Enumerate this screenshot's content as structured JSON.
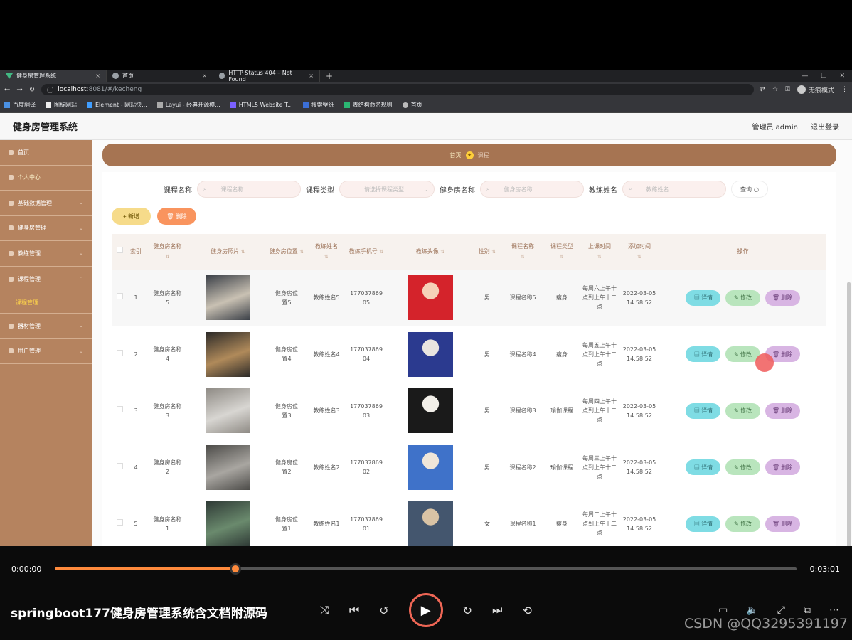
{
  "browser": {
    "tabs": [
      {
        "title": "健身房管理系统",
        "close": "×"
      },
      {
        "title": "首页",
        "close": "×"
      },
      {
        "title": "HTTP Status 404 – Not Found",
        "close": "×"
      }
    ],
    "new_tab": "+",
    "url_host": "localhost",
    "url_path": ":8081/#/kecheng",
    "incognito": "无痕模式",
    "bookmarks": [
      "百度翻译",
      "图标网站",
      "Element - 网站快...",
      "Layui - 经典开源模...",
      "HTML5 Website T...",
      "搜索壁纸",
      "表结构命名规则",
      "首页"
    ]
  },
  "app": {
    "title": "健身房管理系统",
    "user": "管理员 admin",
    "logout": "退出登录"
  },
  "sidebar": {
    "items": [
      {
        "label": "首页"
      },
      {
        "label": "个人中心"
      },
      {
        "label": "基础数据管理"
      },
      {
        "label": "健身房管理"
      },
      {
        "label": "教练管理"
      },
      {
        "label": "课程管理"
      },
      {
        "label": "器材管理"
      },
      {
        "label": "用户管理"
      }
    ],
    "sub_active": "课程管理"
  },
  "breadcrumb": {
    "home": "首页",
    "current": "课程"
  },
  "search": {
    "course_name_label": "课程名称",
    "course_name_placeholder": "课程名称",
    "course_type_label": "课程类型",
    "course_type_placeholder": "请选择课程类型",
    "gym_name_label": "健身房名称",
    "gym_name_placeholder": "健身房名称",
    "coach_name_label": "教练姓名",
    "coach_name_placeholder": "教练姓名",
    "query": "查询"
  },
  "actions": {
    "add": "+ 新增",
    "delete": "删除"
  },
  "table": {
    "headers": [
      "索引",
      "健身房名称",
      "健身房照片",
      "健身房位置",
      "教练姓名",
      "教练手机号",
      "教练头像",
      "性别",
      "课程名称",
      "课程类型",
      "上课时间",
      "添加时间",
      "操作"
    ],
    "rows": [
      {
        "index": "1",
        "gym": "健身房名称5",
        "location": "健身房位置5",
        "coach": "教练姓名5",
        "phone": "17703786905",
        "gender": "男",
        "course": "课程名称5",
        "type": "瘦身",
        "time": "每周六上午十点到上午十二点",
        "added": "2022-03-05 14:58:52"
      },
      {
        "index": "2",
        "gym": "健身房名称4",
        "location": "健身房位置4",
        "coach": "教练姓名4",
        "phone": "17703786904",
        "gender": "男",
        "course": "课程名称4",
        "type": "瘦身",
        "time": "每周五上午十点到上午十二点",
        "added": "2022-03-05 14:58:52"
      },
      {
        "index": "3",
        "gym": "健身房名称3",
        "location": "健身房位置3",
        "coach": "教练姓名3",
        "phone": "17703786903",
        "gender": "男",
        "course": "课程名称3",
        "type": "瑜伽课程",
        "time": "每周四上午十点到上午十二点",
        "added": "2022-03-05 14:58:52"
      },
      {
        "index": "4",
        "gym": "健身房名称2",
        "location": "健身房位置2",
        "coach": "教练姓名2",
        "phone": "17703786902",
        "gender": "男",
        "course": "课程名称2",
        "type": "瑜伽课程",
        "time": "每周三上午十点到上午十二点",
        "added": "2022-03-05 14:58:52"
      },
      {
        "index": "5",
        "gym": "健身房名称1",
        "location": "健身房位置1",
        "coach": "教练姓名1",
        "phone": "17703786901",
        "gender": "女",
        "course": "课程名称1",
        "type": "瘦身",
        "time": "每周二上午十点到上午十二点",
        "added": "2022-03-05 14:58:52"
      }
    ],
    "op_detail": "详情",
    "op_edit": "修改",
    "op_delete": "删除"
  },
  "player": {
    "current_time": "0:00:00",
    "total_time": "0:03:01",
    "progress": 0.245,
    "title": "springboot177健身房管理系统含文档附源码",
    "watermark": "CSDN @QQ3295391197"
  }
}
